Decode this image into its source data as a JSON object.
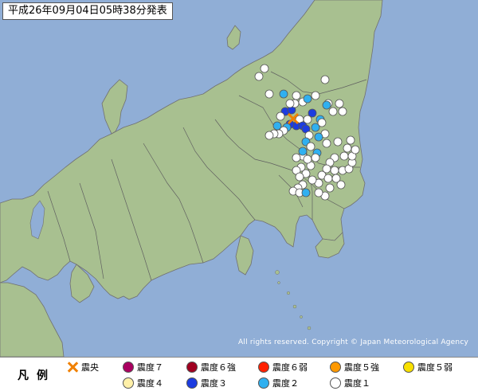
{
  "title": "平成26年09月04日05時38分発表",
  "copyright": "All rights reserved. Copyright © Japan Meteorological Agency",
  "legend": {
    "title": "凡例",
    "items": [
      {
        "key": "epicenter",
        "label": "震央",
        "color": "#f08000"
      },
      {
        "key": "int7",
        "label": "震度７",
        "color": "#aa0060"
      },
      {
        "key": "int6u",
        "label": "震度６強",
        "color": "#a00020"
      },
      {
        "key": "int6l",
        "label": "震度６弱",
        "color": "#ff2000"
      },
      {
        "key": "int5u",
        "label": "震度５強",
        "color": "#ff9900"
      },
      {
        "key": "int5l",
        "label": "震度５弱",
        "color": "#f8e000"
      },
      {
        "key": "int4",
        "label": "震度４",
        "color": "#fff0a8"
      },
      {
        "key": "int3",
        "label": "震度３",
        "color": "#1c3ce0"
      },
      {
        "key": "int2",
        "label": "震度２",
        "color": "#30b0f0"
      },
      {
        "key": "int1",
        "label": "震度１",
        "color": "#ffffff"
      }
    ]
  },
  "colors": {
    "sea": "#90aed6",
    "land": "#a8c090",
    "border": "#606060"
  }
}
